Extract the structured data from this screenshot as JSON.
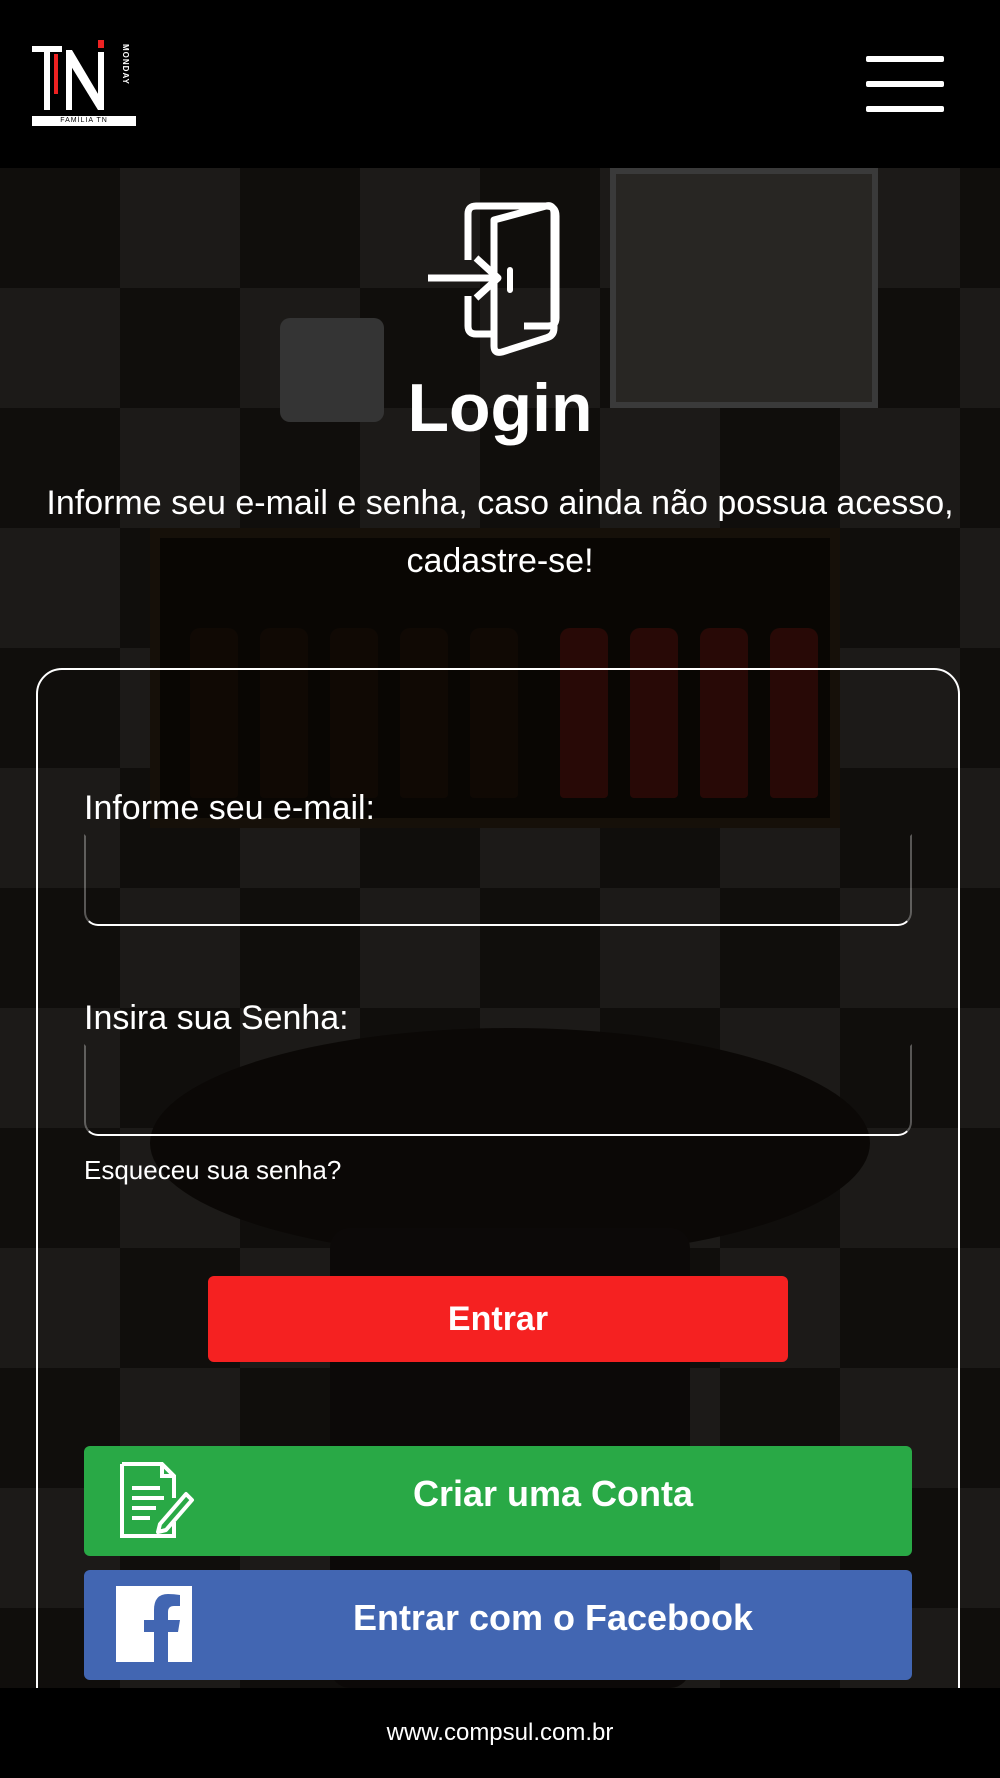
{
  "header": {
    "logo": {
      "mark": "TN",
      "side_text": "MONDAY",
      "tagline": "FAMÍLIA TN"
    },
    "menu_icon": "hamburger-menu-icon"
  },
  "login": {
    "icon": "door-enter-icon",
    "title": "Login",
    "intro": "Informe seu e-mail e senha, caso ainda não possua acesso, cadastre-se!"
  },
  "form": {
    "email_label": "Informe seu e-mail:",
    "email_value": "",
    "password_label": "Insira sua Senha:",
    "password_value": "",
    "forgot_link": "Esqueceu sua senha?",
    "submit_label": "Entrar"
  },
  "actions": {
    "create_account": {
      "label": "Criar uma Conta",
      "icon": "document-edit-icon"
    },
    "facebook": {
      "label": "Entrar com o Facebook",
      "icon": "facebook-icon"
    }
  },
  "footer": {
    "site": "www.compsul.com.br"
  },
  "colors": {
    "submit": "#f52121",
    "create_account": "#29a946",
    "facebook": "#4266b2"
  }
}
